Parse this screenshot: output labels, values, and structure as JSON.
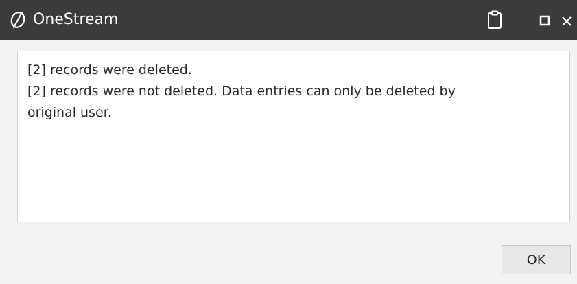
{
  "window": {
    "title": "OneStream",
    "logo_icon": "onestream-logo-icon",
    "clipboard_icon": "clipboard-icon",
    "maximize_icon": "maximize-icon",
    "close_icon": "close-icon"
  },
  "message": {
    "lines": [
      "[2] records were deleted.",
      "[2] records were not deleted. Data entries can only be deleted by",
      "original user."
    ]
  },
  "buttons": {
    "ok_label": "OK"
  },
  "colors": {
    "titlebar_bg": "#3b3b3b",
    "dialog_bg": "#f2f2f2",
    "message_bg": "#ffffff"
  }
}
